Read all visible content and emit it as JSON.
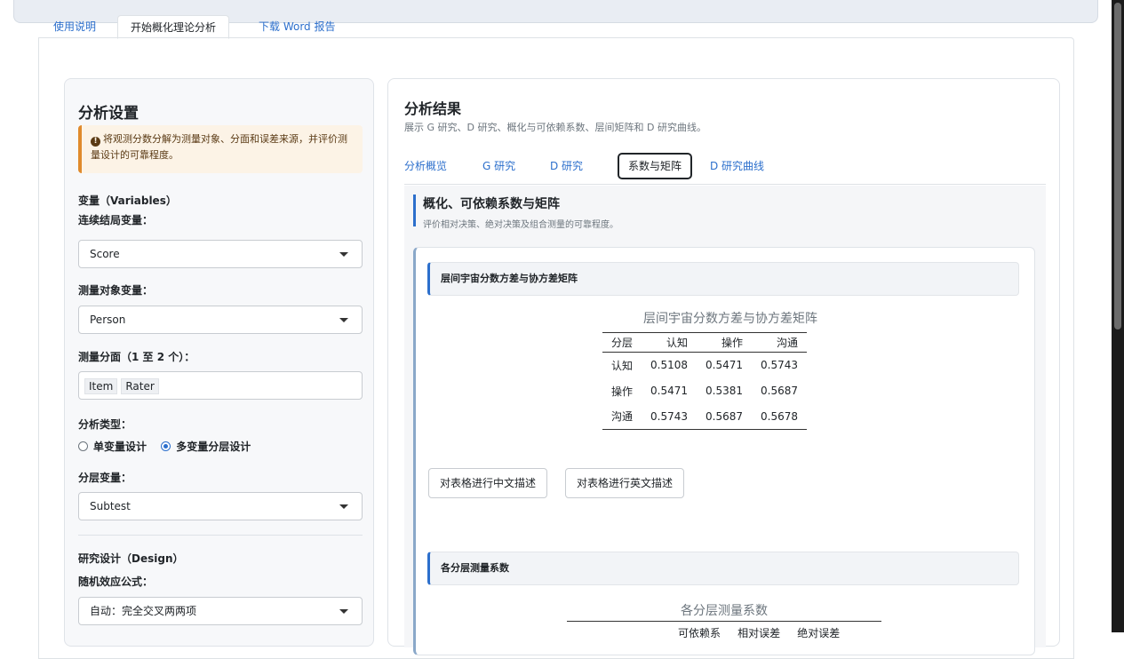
{
  "tabs": [
    {
      "label": "使用说明"
    },
    {
      "label": "开始概化理论分析"
    },
    {
      "label": "下载 Word 报告"
    }
  ],
  "sidebar": {
    "title": "分析设置",
    "alert_text": "将观测分数分解为测量对象、分面和误差来源，并评价测量设计的可靠程度。",
    "variables_heading": "变量（Variables）",
    "outcome_label": "连续结局变量：",
    "outcome_value": "Score",
    "object_label": "测量对象变量：",
    "object_value": "Person",
    "facets_label": "测量分面（1 至 2 个）：",
    "facets": [
      "Item",
      "Rater"
    ],
    "analysis_type_label": "分析类型：",
    "analysis_type_options": [
      "单变量设计",
      "多变量分层设计"
    ],
    "stratum_label": "分层变量：",
    "stratum_value": "Subtest",
    "design_heading": "研究设计（Design）",
    "formula_label": "随机效应公式：",
    "formula_value": "自动：完全交叉两两项"
  },
  "main": {
    "title": "分析结果",
    "subtitle": "展示 G 研究、D 研究、概化与可依赖系数、层间矩阵和 D 研究曲线。",
    "subtabs": [
      "分析概览",
      "G 研究",
      "D 研究",
      "系数与矩阵",
      "D 研究曲线"
    ],
    "section_title": "概化、可依赖系数与矩阵",
    "section_subtitle": "评价相对决策、绝对决策及组合测量的可靠程度。",
    "card1": {
      "header": "层间宇宙分数方差与协方差矩阵",
      "table_caption": "层间宇宙分数方差与协方差矩阵",
      "columns": [
        "分层",
        "认知",
        "操作",
        "沟通"
      ],
      "rows": [
        [
          "认知",
          "0.5108",
          "0.5471",
          "0.5743"
        ],
        [
          "操作",
          "0.5471",
          "0.5381",
          "0.5687"
        ],
        [
          "沟通",
          "0.5743",
          "0.5687",
          "0.5678"
        ]
      ],
      "btn_cn": "对表格进行中文描述",
      "btn_en": "对表格进行英文描述"
    },
    "card2": {
      "header": "各分层测量系数",
      "table_caption": "各分层测量系数",
      "partial_columns": [
        "可依赖系",
        "相对误差",
        "绝对误差"
      ]
    }
  }
}
